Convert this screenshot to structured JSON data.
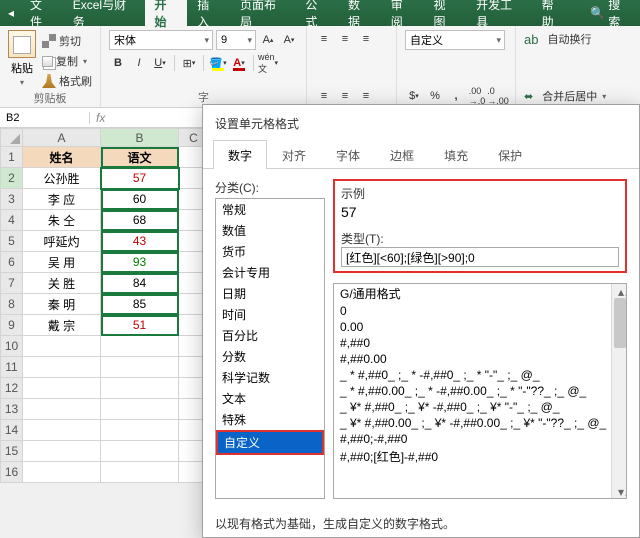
{
  "menubar": {
    "items": [
      "文件",
      "Excel与财务",
      "开始",
      "插入",
      "页面布局",
      "公式",
      "数据",
      "审阅",
      "视图",
      "开发工具",
      "帮助"
    ],
    "active_index": 2,
    "search_label": "搜索"
  },
  "ribbon": {
    "clipboard": {
      "paste": "粘贴",
      "cut": "剪切",
      "copy": "复制",
      "format_painter": "格式刷",
      "group": "剪贴板"
    },
    "font": {
      "name": "宋体",
      "size": "9",
      "group": "字"
    },
    "number_format": "自定义",
    "wrap": "自动换行",
    "merge": "合并后居中"
  },
  "namebox": "B2",
  "formula": "",
  "grid": {
    "cols": [
      "A",
      "B",
      "C"
    ],
    "headers": [
      "姓名",
      "语文"
    ],
    "rows": [
      {
        "n": "2",
        "name": "公孙胜",
        "val": "57",
        "cls": "val-red"
      },
      {
        "n": "3",
        "name": "李  应",
        "val": "60",
        "cls": ""
      },
      {
        "n": "4",
        "name": "朱  仝",
        "val": "68",
        "cls": ""
      },
      {
        "n": "5",
        "name": "呼延灼",
        "val": "43",
        "cls": "val-red"
      },
      {
        "n": "6",
        "name": "吴  用",
        "val": "93",
        "cls": "val-grn"
      },
      {
        "n": "7",
        "name": "关  胜",
        "val": "84",
        "cls": ""
      },
      {
        "n": "8",
        "name": "秦  明",
        "val": "85",
        "cls": ""
      },
      {
        "n": "9",
        "name": "戴  宗",
        "val": "51",
        "cls": "val-red"
      }
    ],
    "empty_rows": [
      "10",
      "11",
      "12",
      "13",
      "14",
      "15",
      "16"
    ]
  },
  "dialog": {
    "title": "设置单元格格式",
    "tabs": [
      "数字",
      "对齐",
      "字体",
      "边框",
      "填充",
      "保护"
    ],
    "active_tab": 0,
    "category_label": "分类(C):",
    "categories": [
      "常规",
      "数值",
      "货币",
      "会计专用",
      "日期",
      "时间",
      "百分比",
      "分数",
      "科学记数",
      "文本",
      "特殊",
      "自定义"
    ],
    "category_selected": 11,
    "sample_label": "示例",
    "sample_value": "57",
    "type_label": "类型(T):",
    "type_value": "[红色][<60];[绿色][>90];0",
    "formats": [
      "G/通用格式",
      "0",
      "0.00",
      "#,##0",
      "#,##0.00",
      "_ * #,##0_ ;_ * -#,##0_ ;_ * \"-\"_ ;_ @_ ",
      "_ * #,##0.00_ ;_ * -#,##0.00_ ;_ * \"-\"??_ ;_ @_ ",
      "_ ¥* #,##0_ ;_ ¥* -#,##0_ ;_ ¥* \"-\"_ ;_ @_ ",
      "_ ¥* #,##0.00_ ;_ ¥* -#,##0.00_ ;_ ¥* \"-\"??_ ;_ @_ ",
      "#,##0;-#,##0",
      "#,##0;[红色]-#,##0"
    ],
    "footer": "以现有格式为基础，生成自定义的数字格式。"
  }
}
